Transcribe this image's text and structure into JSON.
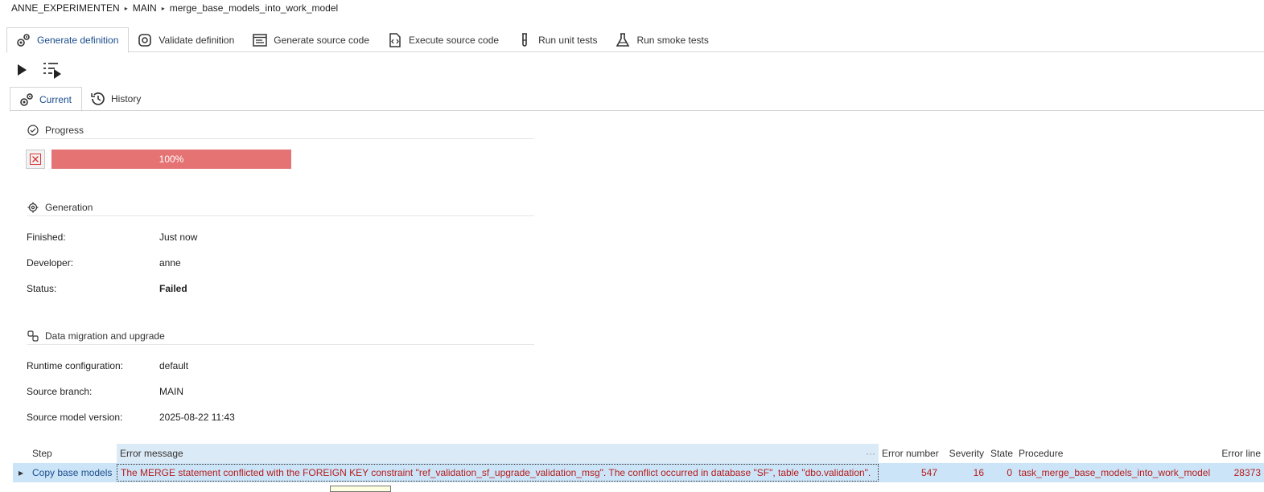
{
  "breadcrumb": {
    "items": [
      "ANNE_EXPERIMENTEN",
      "MAIN",
      "merge_base_models_into_work_model"
    ]
  },
  "main_tabs": [
    {
      "label": "Generate definition",
      "icon": "gears-icon",
      "active": true
    },
    {
      "label": "Validate definition",
      "icon": "gear-check-icon"
    },
    {
      "label": "Generate source code",
      "icon": "source-code-icon"
    },
    {
      "label": "Execute source code",
      "icon": "execute-code-icon"
    },
    {
      "label": "Run unit tests",
      "icon": "test-tube-icon"
    },
    {
      "label": "Run smoke tests",
      "icon": "flask-icon"
    }
  ],
  "toolbar": {
    "buttons": [
      "play-icon",
      "run-list-icon"
    ]
  },
  "sub_tabs": [
    {
      "label": "Current",
      "icon": "gears-icon",
      "active": true
    },
    {
      "label": "History",
      "icon": "history-icon"
    }
  ],
  "progress": {
    "heading": "Progress",
    "percent_text": "100%",
    "fraction": 1.0,
    "bar_color": "#e57373"
  },
  "generation": {
    "heading": "Generation",
    "finished_label": "Finished:",
    "finished_value": "Just now",
    "developer_label": "Developer:",
    "developer_value": "anne",
    "status_label": "Status:",
    "status_value": "Failed"
  },
  "migration": {
    "heading": "Data migration and upgrade",
    "runtime_label": "Runtime configuration:",
    "runtime_value": "default",
    "branch_label": "Source branch:",
    "branch_value": "MAIN",
    "version_label": "Source model version:",
    "version_value": "2025-08-22 11:43"
  },
  "error_grid": {
    "columns": {
      "step": "Step",
      "message": "Error message",
      "error_number": "Error number",
      "severity": "Severity",
      "state": "State",
      "procedure": "Procedure",
      "error_line": "Error line"
    },
    "rows": [
      {
        "step": "Copy base models",
        "message": "The MERGE statement conflicted with the FOREIGN KEY constraint \"ref_validation_sf_upgrade_validation_msg\". The conflict occurred in database \"SF\", table \"dbo.validation\".",
        "error_number": "547",
        "severity": "16",
        "state": "0",
        "procedure": "task_merge_base_models_into_work_model",
        "error_line": "28373"
      }
    ]
  },
  "colors": {
    "accent": "#1a4d8c",
    "error_text": "#b71c1c",
    "selected_row": "#cce4f7"
  }
}
